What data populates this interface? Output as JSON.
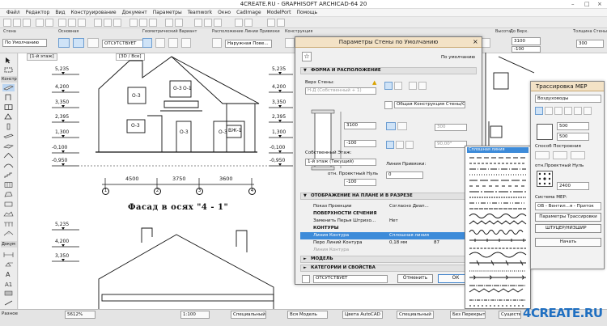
{
  "window": {
    "title": "4CREATE.RU - GRAPHISOFT ARCHICAD-64 20",
    "controls": [
      "–",
      "□",
      "×"
    ]
  },
  "menu": [
    "Файл",
    "Редактор",
    "Вид",
    "Конструирование",
    "Документ",
    "Параметры",
    "Teamwork",
    "Окно",
    "CadImage",
    "ModelPort",
    "Помощь"
  ],
  "toolbar": {
    "default_label": "По Умолчанию",
    "main_label": "Основная",
    "geometry_label": "Геометрический Вариант",
    "ref_line_label": "Расположение Линии Привязки",
    "structure_label": "Конструкция",
    "thickness_label": "Толщина Стены",
    "height_label": "Высота",
    "to_top_label": "До Верх.",
    "absent_value": "ОТСУТСТВУЕТ",
    "outer_label": "Наружная Пове...",
    "thickness_value": "300",
    "height_value": "3100",
    "top_value": "-100"
  },
  "toolbox": {
    "construct_label": "Констр",
    "document_label": "Докум",
    "more_label": "Разное"
  },
  "tabs": {
    "floor": "[1-й этаж]",
    "view3d": "[3D / Все]"
  },
  "drawing": {
    "levels_upper": [
      "5,235",
      "4,200",
      "3,350",
      "2,395",
      "1,300",
      "-0,100",
      "-0,950"
    ],
    "levels_lower": [
      "5,235",
      "4,200",
      "3,350"
    ],
    "levels_right": [
      "5,235",
      "4,200",
      "3,350",
      "2,395",
      "1,300",
      "-0,100",
      "-0,950"
    ],
    "dims": [
      "4500",
      "3750",
      "3600"
    ],
    "axes": [
      "1",
      "2",
      "3",
      "4"
    ],
    "window_tags": [
      "О-3",
      "О-3",
      "О-3",
      "О-3",
      "О-3",
      "О-1",
      "ВЖ-1"
    ],
    "facade_title": "Фасад в осях \"4 - 1\""
  },
  "wall_dialog": {
    "title": "Параметры Стены по Умолчанию",
    "default_label": "По умолчанию",
    "section_geometry": "ФОРМА И РАСПОЛОЖЕНИЕ",
    "top_label": "Верх Стены:",
    "top_value": "Н-Д (Собственный + 1)",
    "structure_value": "Общая Конструкция Стены/Обо...",
    "val_3100": "3100",
    "val_minus100": "-100",
    "val_300": "300",
    "val_90": "90,00°",
    "own_floor_label": "Собственный Этаж:",
    "own_floor_value": "1-й этаж (Текущий)",
    "rel_zero_label": "отн. Проектный Нуль",
    "rel_zero_value": "-100",
    "ref_line_label": "Линия Привязки:",
    "ref_line_value": "0",
    "section_plan": "ОТОБРАЖЕНИЕ НА ПЛАНЕ И В РАЗРЕЗЕ",
    "rows": [
      {
        "name": "Показ Проекции",
        "value": "Согласно Диап..."
      },
      {
        "name": "ПОВЕРХНОСТИ СЕЧЕНИЯ",
        "value": ""
      },
      {
        "name": "Заменить Перья Штрихо...",
        "value": "Нет"
      },
      {
        "name": "КОНТУРЫ",
        "value": ""
      },
      {
        "name": "Линия Контура",
        "value": "Сплошная линия"
      },
      {
        "name": "Перо Линий Контура",
        "value": "0,18 мм"
      },
      {
        "name": "Линия Контура",
        "value": ""
      }
    ],
    "pen_number": "87",
    "section_model": "МОДЕЛЬ",
    "section_categories": "КАТЕГОРИИ И СВОЙСТВА",
    "layer_value": "ОТСУТСТВУЕТ",
    "cancel_label": "Отменить",
    "ok_label": "ОК"
  },
  "line_dropdown": {
    "selected": "Сплошная линия"
  },
  "mep": {
    "title": "Трассировка MEP",
    "system_top": "Воздуховоды",
    "val_500a": "500",
    "val_500b": "500",
    "method_label": "Способ Построения",
    "rel_label": "отн.Проектный Нуль",
    "val_2400": "2400",
    "system_label": "Система MEP:",
    "system_value": "ОВ - Вентил...я - Приток",
    "params_btn": "Параметры Трассировки",
    "fittings": "ШТУЦЕР/НИЗШИР",
    "start_btn": "Начать"
  },
  "status": {
    "more": "Разное",
    "nav1": "5612%",
    "zoom_value": "1:100",
    "special1": "Специальный",
    "all_model": "Вся Модель",
    "acad_colors": "Цвета AutoCAD",
    "special2": "Специальный",
    "floor_value": "Специальный",
    "no_override": "Без Перекрытия",
    "existing": "Существующие"
  },
  "logo": {
    "four": "4",
    "text": "CREATE.RU"
  }
}
